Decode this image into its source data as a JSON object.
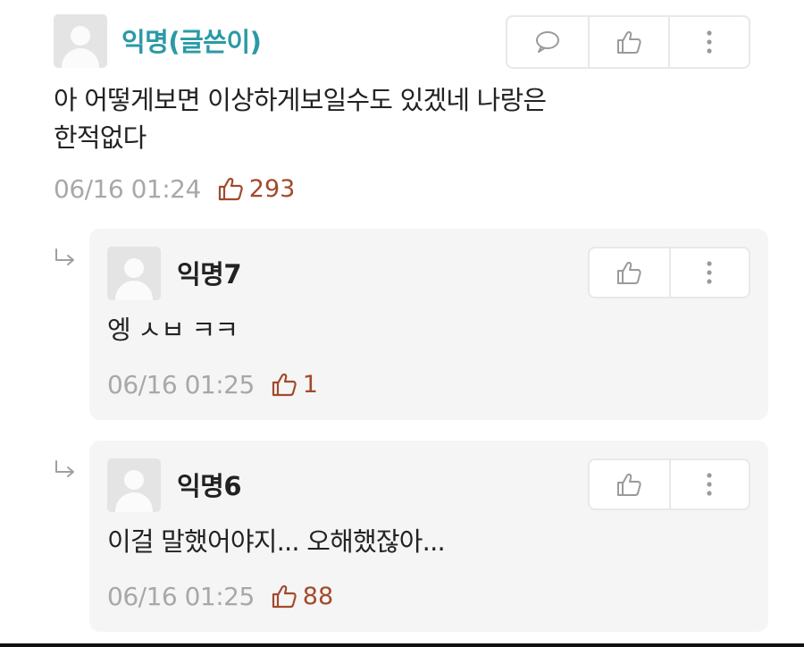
{
  "comment": {
    "author": "익명(글쓴이)",
    "author_color": "#2a9aa5",
    "text_line1": "아 어떻게보면 이상하게보일수도 있겠네 나랑은",
    "text_line2": "한적없다",
    "time": "06/16 01:24",
    "likes": "293"
  },
  "replies": [
    {
      "author": "익명7",
      "text": "엥 ㅅㅂ ㅋㅋ",
      "time": "06/16 01:25",
      "likes": "1"
    },
    {
      "author": "익명6",
      "text": "이걸 말했어야지... 오해했잖아...",
      "time": "06/16 01:25",
      "likes": "88"
    }
  ],
  "icons": {
    "reply": "speech-bubble-icon",
    "like": "thumbs-up-icon",
    "more": "vertical-dots-icon",
    "reply_arrow": "reply-arrow-icon"
  },
  "colors": {
    "like_count": "#a24a2c",
    "timestamp": "#a8a8a8",
    "reply_bg": "#f5f5f5"
  }
}
